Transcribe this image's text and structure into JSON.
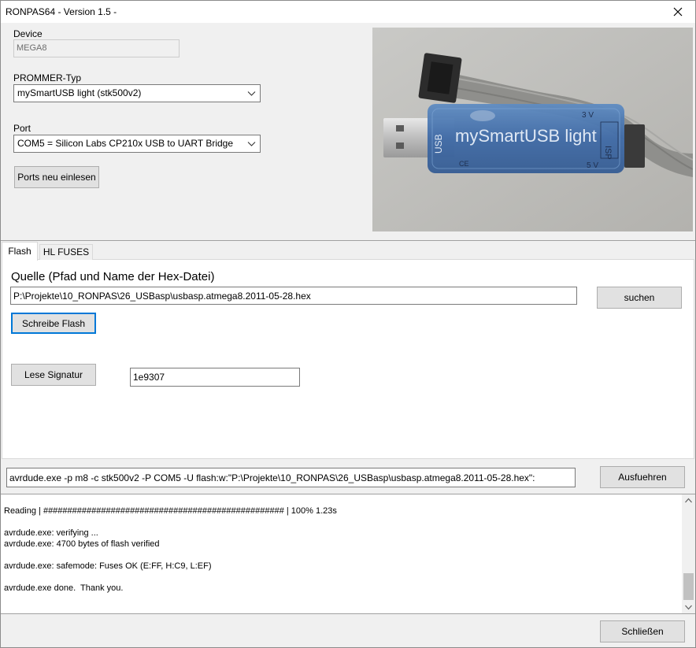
{
  "window": {
    "title": "RONPAS64 - Version 1.5 -"
  },
  "device": {
    "label": "Device",
    "value": "MEGA8"
  },
  "prommer": {
    "label": "PROMMER-Typ",
    "value": "mySmartUSB light (stk500v2)"
  },
  "port": {
    "label": "Port",
    "value": "COM5 = Silicon Labs CP210x USB to UART Bridge"
  },
  "buttons": {
    "ports_reload": "Ports neu einlesen",
    "search": "suchen",
    "write_flash": "Schreibe Flash",
    "read_signature": "Lese Signatur",
    "execute": "Ausfuehren",
    "close": "Schließen"
  },
  "photo": {
    "brand_text": "mySmartUSB light",
    "voltage_3v": "3 V",
    "voltage_5v": "5 V",
    "isp_text": "ISP",
    "ce_text": "CE",
    "usb_text": "USB"
  },
  "tabs": [
    {
      "label": "Flash"
    },
    {
      "label": "HL FUSES"
    }
  ],
  "flash": {
    "source_label": "Quelle (Pfad und Name der Hex-Datei)",
    "source_path": "P:\\Projekte\\10_RONPAS\\26_USBasp\\usbasp.atmega8.2011-05-28.hex",
    "signature_value": "1e9307"
  },
  "command": {
    "value": "avrdude.exe -p m8 -c stk500v2 -P COM5 -U flash:w:\"P:\\Projekte\\10_RONPAS\\26_USBasp\\usbasp.atmega8.2011-05-28.hex\":"
  },
  "log": {
    "lines": "Reading | ################################################## | 100% 1.23s\n\navrdude.exe: verifying ...\navrdude.exe: 4700 bytes of flash verified\n\navrdude.exe: safemode: Fuses OK (E:FF, H:C9, L:EF)\n\navrdude.exe done.  Thank you."
  }
}
